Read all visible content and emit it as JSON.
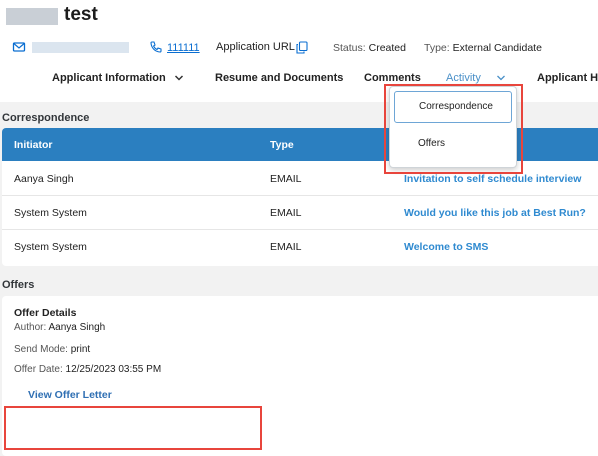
{
  "header": {
    "name": "test",
    "phone": "111111",
    "app_url_label": "Application URL",
    "status_label": "Status:",
    "status_value": "Created",
    "type_label": "Type:",
    "type_value": "External Candidate"
  },
  "nav": {
    "items": [
      {
        "label": "Applicant Information"
      },
      {
        "label": "Resume and Documents"
      },
      {
        "label": "Comments"
      },
      {
        "label": "Activity"
      },
      {
        "label": "Applicant Hi"
      }
    ]
  },
  "dropdown": {
    "items": [
      {
        "label": "Correspondence"
      },
      {
        "label": "Offers"
      }
    ]
  },
  "correspondence": {
    "title": "Correspondence",
    "headers": [
      "Initiator",
      "Type"
    ],
    "rows": [
      {
        "initiator": "Aanya Singh",
        "type": "EMAIL",
        "subject": "Invitation to self schedule interview"
      },
      {
        "initiator": "System System",
        "type": "EMAIL",
        "subject": "Would you like this job at Best Run?"
      },
      {
        "initiator": "System System",
        "type": "EMAIL",
        "subject": "Welcome to SMS"
      }
    ]
  },
  "offers": {
    "title": "Offers",
    "details_title": "Offer Details",
    "author_label": "Author:",
    "author_value": "Aanya Singh",
    "send_mode_label": "Send Mode:",
    "send_mode_value": "print",
    "offer_date_label": "Offer Date:",
    "offer_date_value": "12/25/2023 03:55 PM",
    "view_link": "View Offer Letter"
  },
  "colors": {
    "accent": "#2b7fc0",
    "link": "#2f8ad0",
    "highlight": "#e8453c"
  }
}
